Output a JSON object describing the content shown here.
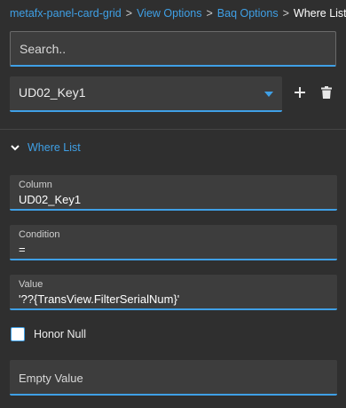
{
  "breadcrumb": {
    "items": [
      "metafx-panel-card-grid",
      "View Options",
      "Baq Options"
    ],
    "separator": ">",
    "current": "Where List"
  },
  "search": {
    "placeholder": "Search.."
  },
  "where_select": {
    "value": "UD02_Key1"
  },
  "actions": {
    "add_icon": "plus-icon",
    "delete_icon": "trash-icon"
  },
  "section": {
    "title": "Where List",
    "expanded": true
  },
  "fields": {
    "column": {
      "label": "Column",
      "value": "UD02_Key1"
    },
    "condition": {
      "label": "Condition",
      "value": "="
    },
    "value": {
      "label": "Value",
      "value": "'??{TransView.FilterSerialNum}'"
    },
    "honor_null": {
      "label": "Honor Null",
      "checked": false
    },
    "empty_value": {
      "placeholder": "Empty Value"
    }
  },
  "colors": {
    "background": "#2f2f2f",
    "field_background": "#3d3d3d",
    "accent": "#3fa0e6",
    "text": "#e8e8e8"
  }
}
